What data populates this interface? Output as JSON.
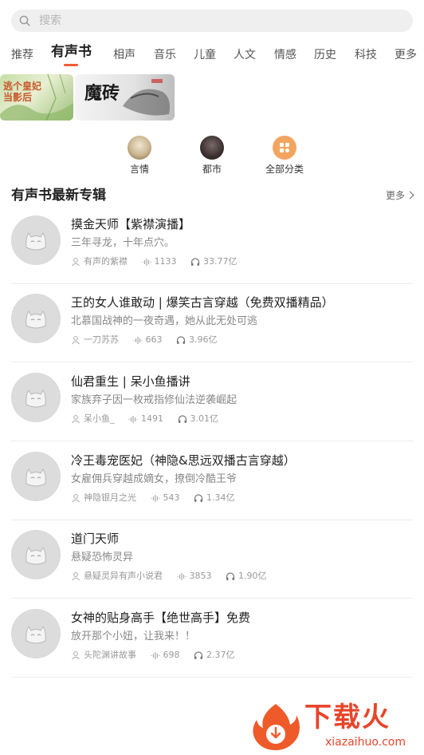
{
  "search": {
    "placeholder": "搜索"
  },
  "tabs": [
    {
      "label": "推荐"
    },
    {
      "label": "有声书"
    },
    {
      "label": "相声"
    },
    {
      "label": "音乐"
    },
    {
      "label": "儿童"
    },
    {
      "label": "人文"
    },
    {
      "label": "情感"
    },
    {
      "label": "历史"
    },
    {
      "label": "科技"
    },
    {
      "label": "更多"
    }
  ],
  "banners": [
    {
      "text": "逃个皇妃当影后"
    },
    {
      "text": "魔砖"
    }
  ],
  "categories": [
    {
      "label": "言情"
    },
    {
      "label": "都市"
    },
    {
      "label": "全部分类"
    }
  ],
  "section": {
    "title": "有声书最新专辑",
    "more": "更多"
  },
  "albums": [
    {
      "title": "摸金天师【紫襟演播】",
      "intro": "三年寻龙，十年点穴。",
      "author": "有声的紫襟",
      "tracks": "1133",
      "plays": "33.77亿"
    },
    {
      "title": "王的女人谁敢动 | 爆笑古言穿越（免费双播精品）",
      "intro": "北慕国战神的一夜奇遇，她从此无处可逃",
      "author": "一刀苏苏",
      "tracks": "663",
      "plays": "3.96亿"
    },
    {
      "title": "仙君重生 | 呆小鱼播讲",
      "intro": "家族弃子因一枚戒指修仙法逆袭崛起",
      "author": "呆小鱼_",
      "tracks": "1491",
      "plays": "3.01亿"
    },
    {
      "title": "冷王毒宠医妃（神隐&思远双播古言穿越）",
      "intro": "女雇佣兵穿越成嫡女，撩倒冷酷王爷",
      "author": "神隐银月之光",
      "tracks": "543",
      "plays": "1.34亿"
    },
    {
      "title": "道门天师",
      "intro": "悬疑恐怖灵异",
      "author": "悬疑灵异有声小说君",
      "tracks": "3853",
      "plays": "1.90亿"
    },
    {
      "title": "女神的贴身高手【绝世高手】免费",
      "intro": "放开那个小妞，让我来！！",
      "author": "头陀渊讲故事",
      "tracks": "698",
      "plays": "2.37亿"
    }
  ],
  "watermark": {
    "text": "下载火",
    "url": "xiazaihuo.com"
  },
  "colors": {
    "accent": "#f15a31",
    "watermark": "#e8452b"
  }
}
